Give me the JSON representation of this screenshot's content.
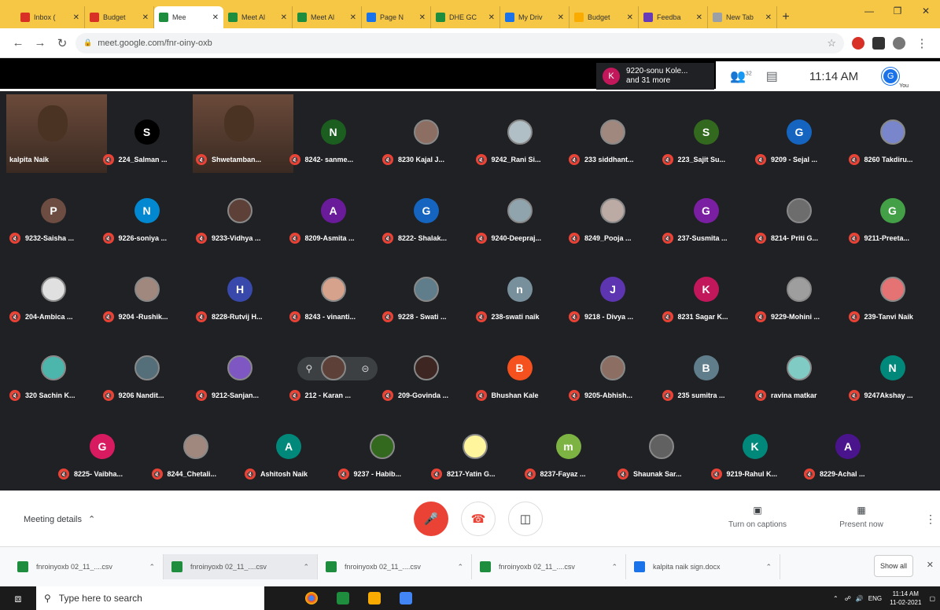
{
  "browser": {
    "tabs": [
      {
        "label": "Inbox (",
        "color": "#d93025"
      },
      {
        "label": "Budget",
        "color": "#d93025"
      },
      {
        "label": "Mee",
        "color": "#1e8e3e",
        "active": true
      },
      {
        "label": "Meet Al",
        "color": "#1e8e3e"
      },
      {
        "label": "Meet Al",
        "color": "#1e8e3e"
      },
      {
        "label": "Page N",
        "color": "#1a73e8"
      },
      {
        "label": "DHE GC",
        "color": "#1e8e3e"
      },
      {
        "label": "My Driv",
        "color": "#1a73e8"
      },
      {
        "label": "Budget",
        "color": "#f9ab00"
      },
      {
        "label": "Feedba",
        "color": "#673ab7"
      },
      {
        "label": "New Tab",
        "color": "#9aa0a6"
      }
    ],
    "new_tab": "+",
    "url": "meet.google.com/fnr-oiny-oxb"
  },
  "meet_top": {
    "participants_initial": "K",
    "participants_line1": "9220-sonu Kole...",
    "participants_line2": "and 31 more",
    "people_count": "32",
    "time": "11:14 AM",
    "you_initial": "G",
    "you_label": "You"
  },
  "tiles": [
    {
      "name": "kalpita Naik",
      "type": "video",
      "col": 0,
      "row": 0
    },
    {
      "name": "224_Salman ...",
      "initial": "S",
      "color": "#000000",
      "col": 1,
      "row": 0
    },
    {
      "name": "Shwetamban...",
      "type": "video",
      "col": 2,
      "row": 0
    },
    {
      "name": "8242- sanme...",
      "initial": "N",
      "color": "#1b5e20",
      "col": 3,
      "row": 0
    },
    {
      "name": "8230 Kajal J...",
      "photo": "#8d6e63",
      "col": 4,
      "row": 0
    },
    {
      "name": "9242_Rani Si...",
      "photo": "#b0bec5",
      "col": 5,
      "row": 0
    },
    {
      "name": "233 siddhant...",
      "photo": "#a1887f",
      "col": 6,
      "row": 0
    },
    {
      "name": "223_Sajit Su...",
      "initial": "S",
      "color": "#33691e",
      "col": 7,
      "row": 0
    },
    {
      "name": "9209 - Sejal ...",
      "initial": "G",
      "color": "#1565c0",
      "col": 8,
      "row": 0
    },
    {
      "name": "8260 Takdiru...",
      "photo": "#7986cb",
      "col": 9,
      "row": 0
    },
    {
      "name": "9232-Saisha ...",
      "initial": "P",
      "color": "#6d4c41",
      "col": 0,
      "row": 1
    },
    {
      "name": "9226-soniya ...",
      "initial": "N",
      "color": "#0288d1",
      "col": 1,
      "row": 1
    },
    {
      "name": "9233-Vidhya ...",
      "photo": "#5d4037",
      "col": 2,
      "row": 1
    },
    {
      "name": "8209-Asmita ...",
      "initial": "A",
      "color": "#6a1b9a",
      "col": 3,
      "row": 1
    },
    {
      "name": "8222- Shalak...",
      "initial": "G",
      "color": "#1565c0",
      "col": 4,
      "row": 1
    },
    {
      "name": "9240-Deepraj...",
      "photo": "#90a4ae",
      "col": 5,
      "row": 1
    },
    {
      "name": "8249_Pooja ...",
      "photo": "#bcaaa4",
      "col": 6,
      "row": 1
    },
    {
      "name": "237-Susmita ...",
      "initial": "G",
      "color": "#7b1fa2",
      "col": 7,
      "row": 1
    },
    {
      "name": "8214- Priti G...",
      "photo": "#6d6d6d",
      "col": 8,
      "row": 1
    },
    {
      "name": "9211-Preeta...",
      "initial": "G",
      "color": "#43a047",
      "col": 9,
      "row": 1
    },
    {
      "name": "204-Ambica ...",
      "photo": "#e0e0e0",
      "col": 0,
      "row": 2
    },
    {
      "name": "9204 -Rushik...",
      "photo": "#a1887f",
      "col": 1,
      "row": 2
    },
    {
      "name": "8228-Rutvij H...",
      "initial": "H",
      "color": "#3949ab",
      "col": 2,
      "row": 2
    },
    {
      "name": "8243 - vinanti...",
      "photo": "#d7a28c",
      "col": 3,
      "row": 2
    },
    {
      "name": "9228 - Swati ...",
      "photo": "#607d8b",
      "col": 4,
      "row": 2
    },
    {
      "name": "238-swati naik",
      "initial": "n",
      "color": "#78909c",
      "col": 5,
      "row": 2
    },
    {
      "name": "9218 - Divya ...",
      "initial": "J",
      "color": "#5e35b1",
      "col": 6,
      "row": 2
    },
    {
      "name": "8231 Sagar K...",
      "initial": "K",
      "color": "#c2185b",
      "col": 7,
      "row": 2
    },
    {
      "name": "9229-Mohini ...",
      "photo": "#9e9e9e",
      "col": 8,
      "row": 2
    },
    {
      "name": "239-Tanvi Naik",
      "photo": "#e57373",
      "col": 9,
      "row": 2
    },
    {
      "name": "320 Sachin K...",
      "photo": "#4db6ac",
      "col": 0,
      "row": 3
    },
    {
      "name": "9206 Nandit...",
      "photo": "#546e7a",
      "col": 1,
      "row": 3
    },
    {
      "name": "9212-Sanjan...",
      "photo": "#7e57c2",
      "col": 2,
      "row": 3
    },
    {
      "name": "212 - Karan ...",
      "photo": "#5d4037",
      "col": 3,
      "row": 3
    },
    {
      "name": "209-Govinda ...",
      "photo": "#3e2723",
      "col": 4,
      "row": 3
    },
    {
      "name": "Bhushan Kale",
      "initial": "B",
      "color": "#f4511e",
      "col": 5,
      "row": 3
    },
    {
      "name": "9205-Abhish...",
      "photo": "#8d6e63",
      "col": 6,
      "row": 3
    },
    {
      "name": "235 sumitra ...",
      "initial": "B",
      "color": "#607d8b",
      "col": 7,
      "row": 3
    },
    {
      "name": "ravina matkar",
      "photo": "#80cbc4",
      "col": 8,
      "row": 3
    },
    {
      "name": "9247Akshay ...",
      "initial": "N",
      "color": "#00897b",
      "col": 9,
      "row": 3
    },
    {
      "name": "8225- Vaibha...",
      "initial": "G",
      "color": "#d81b60",
      "col": 0,
      "row": 4
    },
    {
      "name": "8244_Chetali...",
      "photo": "#a1887f",
      "col": 1,
      "row": 4
    },
    {
      "name": "Ashitosh Naik",
      "initial": "A",
      "color": "#00897b",
      "col": 2,
      "row": 4
    },
    {
      "name": "9237 - Habib...",
      "photo": "#33691e",
      "col": 3,
      "row": 4
    },
    {
      "name": "8217-Yatin G...",
      "photo": "#fff59d",
      "col": 4,
      "row": 4
    },
    {
      "name": "8237-Fayaz ...",
      "initial": "m",
      "color": "#7cb342",
      "col": 5,
      "row": 4
    },
    {
      "name": "Shaunak Sar...",
      "photo": "#616161",
      "col": 6,
      "row": 4
    },
    {
      "name": "9219-Rahul K...",
      "initial": "K",
      "color": "#00897b",
      "col": 7,
      "row": 4
    },
    {
      "name": "8229-Achal ...",
      "initial": "A",
      "color": "#4a148c",
      "col": 8,
      "row": 4
    }
  ],
  "controls": {
    "meeting_details": "Meeting details",
    "captions": "Turn on captions",
    "present": "Present now"
  },
  "downloads": [
    {
      "name": "fnroinyoxb 02_11_....csv",
      "type": "csv"
    },
    {
      "name": "fnroinyoxb 02_11_....csv",
      "type": "csv",
      "active": true
    },
    {
      "name": "fnroinyoxb 02_11_....csv",
      "type": "csv"
    },
    {
      "name": "fnroinyoxb 02_11_....csv",
      "type": "csv"
    },
    {
      "name": "kalpita naik sign.docx",
      "type": "doc"
    }
  ],
  "show_all": "Show all",
  "taskbar": {
    "search_placeholder": "Type here to search",
    "lang": "ENG",
    "time": "11:14 AM",
    "date": "11-02-2021"
  }
}
